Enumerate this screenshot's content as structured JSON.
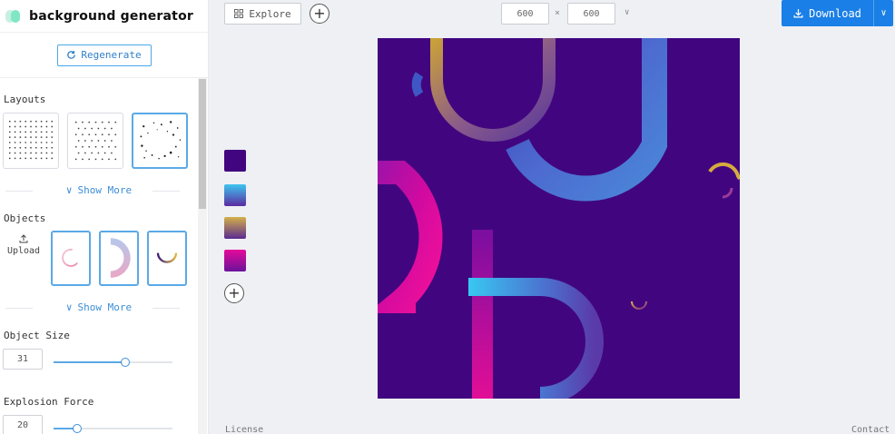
{
  "app": {
    "title": "background generator"
  },
  "sidebar": {
    "regenerate_label": "Regenerate",
    "layouts_label": "Layouts",
    "objects_label": "Objects",
    "show_more_label": "Show More",
    "upload_label": "Upload",
    "object_size": {
      "label": "Object Size",
      "value": "31",
      "fraction": 0.6
    },
    "explosion_force": {
      "label": "Explosion Force",
      "value": "20",
      "fraction": 0.2
    }
  },
  "toolbar": {
    "explore_label": "Explore",
    "width_value": "600",
    "height_value": "600",
    "separator": "×",
    "download_label": "Download"
  },
  "colors": {
    "canvas_background": "#41067f",
    "swatches": [
      {
        "name": "deep-purple",
        "color": "#41067f"
      },
      {
        "name": "cyan-to-purple",
        "gradient": [
          "#3ec6f0",
          "#5a2aa0"
        ]
      },
      {
        "name": "gold-to-purple",
        "gradient": [
          "#d4b04a",
          "#5a2a90"
        ]
      },
      {
        "name": "magenta-to-purple",
        "gradient": [
          "#e60a9a",
          "#6a129a"
        ]
      }
    ],
    "accent": "#1a7fe6"
  },
  "footer": {
    "license_label": "License",
    "contact_label": "Contact"
  }
}
